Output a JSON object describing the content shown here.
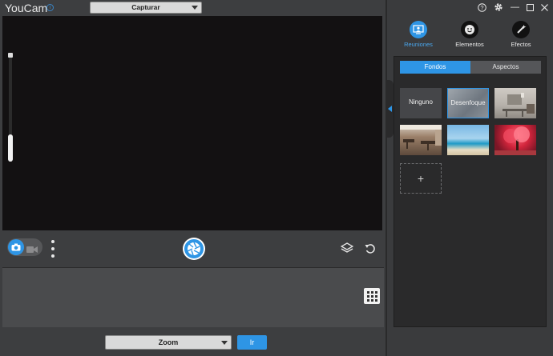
{
  "app": {
    "title": "YouCam"
  },
  "mode_select": {
    "value": "Capturar"
  },
  "bottom": {
    "zoom_value": "Zoom",
    "go_label": "Ir"
  },
  "categories": [
    {
      "label": "Reuniones",
      "icon": "meeting-icon",
      "active": true
    },
    {
      "label": "Elementos",
      "icon": "sticker-icon",
      "active": false
    },
    {
      "label": "Efectos",
      "icon": "magic-wand-icon",
      "active": false
    }
  ],
  "segments": {
    "backgrounds": "Fondos",
    "appearance": "Aspectos"
  },
  "backgrounds": {
    "none": "Ninguno",
    "blur": "Desenfoque"
  },
  "add_tile": "+",
  "colors": {
    "accent": "#2e95e5",
    "preview": "#131112",
    "panel": "#3a3b3d"
  },
  "zoom_slider_level": 0.2
}
